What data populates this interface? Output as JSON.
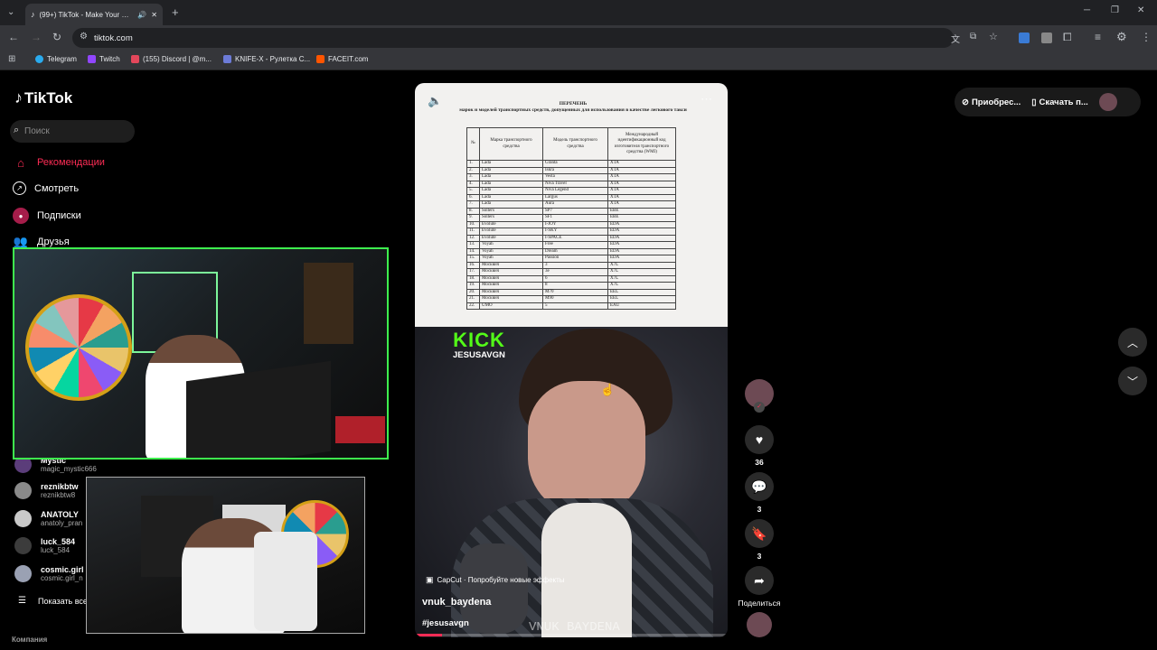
{
  "browser": {
    "tab_title": "(99+) TikTok - Make Your Day",
    "url": "tiktok.com",
    "bookmarks": [
      {
        "label": "Telegram",
        "color": "#2aabee"
      },
      {
        "label": "Twitch",
        "color": "#9146ff"
      },
      {
        "label": "(155) Discord | @m...",
        "color": "#e3475b"
      },
      {
        "label": "KNIFE-X - Рулетка С...",
        "color": "#6c7bd7"
      },
      {
        "label": "FACEIT.com",
        "color": "#ff5500"
      }
    ]
  },
  "tiktok": {
    "logo": "TikTok",
    "search_placeholder": "Поиск",
    "nav": [
      {
        "label": "Рекомендации",
        "icon": "home-icon"
      },
      {
        "label": "Смотреть",
        "icon": "compass-icon"
      },
      {
        "label": "Подписки",
        "icon": "following-icon"
      },
      {
        "label": "Друзья",
        "icon": "friends-icon"
      }
    ],
    "following": [
      {
        "name": "Mystic",
        "user": "magic_mystic666"
      },
      {
        "name": "reznikbtw",
        "user": "reznikbtw8"
      },
      {
        "name": "ANATOLY",
        "user": "anatoly_pran"
      },
      {
        "name": "luck_584",
        "user": "luck_584"
      },
      {
        "name": "cosmic.girl",
        "user": "cosmic.girl_n"
      }
    ],
    "show_all": "Показать все",
    "footer": "Компания",
    "top_actions": {
      "get_coins": "Приобрес...",
      "download": "Скачать п..."
    }
  },
  "video": {
    "doc_heading": "ПЕРЕЧЕНЬ",
    "doc_subheading": "марок и моделей транспортных средств, допущенных для использования в качестве легкового такси",
    "doc_columns": [
      "№",
      "Марка транспортного средства",
      "Модель транспортного средства",
      "Международный идентификационный код изготовителя транспортного средства (WMI)"
    ],
    "doc_rows": [
      [
        "1.",
        "Lada",
        "Granta",
        "XTA"
      ],
      [
        "2.",
        "Lada",
        "Iskra",
        "XTA"
      ],
      [
        "3.",
        "Lada",
        "Vesta",
        "XTA"
      ],
      [
        "4.",
        "Lada",
        "Niva Travel",
        "XTA"
      ],
      [
        "5.",
        "Lada",
        "Niva Legend",
        "XTA"
      ],
      [
        "6.",
        "Lada",
        "Largus",
        "XTA"
      ],
      [
        "7.",
        "Lada",
        "Aura",
        "XTA"
      ],
      [
        "8.",
        "Sollers",
        "SP7",
        "EBE"
      ],
      [
        "9.",
        "Sollers",
        "SF1",
        "EBE"
      ],
      [
        "10.",
        "Evolute",
        "I-JOY",
        "EDA"
      ],
      [
        "11.",
        "Evolute",
        "I-SKY",
        "EDA"
      ],
      [
        "12.",
        "Evolute",
        "I-SPACE",
        "EDA"
      ],
      [
        "13.",
        "Voyah",
        "Free",
        "EDA"
      ],
      [
        "14.",
        "Voyah",
        "Dream",
        "EDA"
      ],
      [
        "15.",
        "Voyah",
        "Passion",
        "EDA"
      ],
      [
        "16.",
        "Москвич",
        "3",
        "X7L"
      ],
      [
        "17.",
        "Москвич",
        "3е",
        "X7L"
      ],
      [
        "18.",
        "Москвич",
        "6",
        "X7L"
      ],
      [
        "19.",
        "Москвич",
        "8",
        "X7L"
      ],
      [
        "20.",
        "Москвич",
        "M70",
        "EEL"
      ],
      [
        "21.",
        "Москвич",
        "M90",
        "EEL"
      ],
      [
        "22.",
        "UMO",
        "5",
        "EAU"
      ]
    ],
    "kick_label": "KICK",
    "kick_user": "JESUSAVGN",
    "capcut": "CapCut · Попробуйте новые эффекты",
    "author": "vnuk_baydena",
    "hashtag": "#jesusavgn",
    "watermark": "VNUK BAYDENA"
  },
  "actions": {
    "likes": "36",
    "comments": "3",
    "saves": "3",
    "share_label": "Поделиться"
  }
}
